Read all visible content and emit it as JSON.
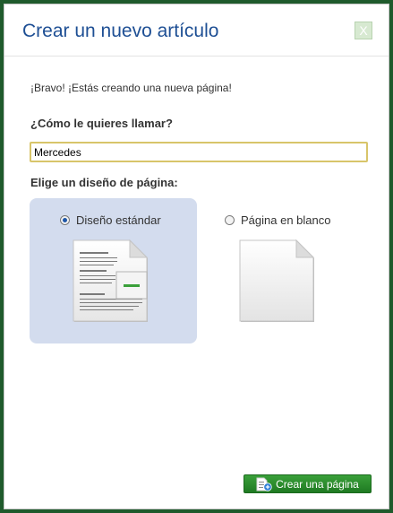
{
  "dialog": {
    "title": "Crear un nuevo artículo",
    "close_label": "X",
    "intro": "¡Bravo! ¡Estás creando una nueva página!",
    "name_prompt": "¿Cómo le quieres llamar?",
    "name_value": "Mercedes",
    "layout_prompt": "Elige un diseño de página:",
    "layouts": [
      {
        "label": "Diseño estándar",
        "selected": true
      },
      {
        "label": "Página en blanco",
        "selected": false
      }
    ],
    "submit_label": "Crear una página"
  },
  "icons": {
    "close": "close-icon",
    "standard_layout": "standard-layout-page-icon",
    "blank_layout": "blank-page-icon",
    "create": "add-page-icon"
  },
  "colors": {
    "title": "#1e4f94",
    "selected_option_bg": "#d3dcee",
    "button_green": "#2a8c2d",
    "input_border": "#d8c56a"
  }
}
